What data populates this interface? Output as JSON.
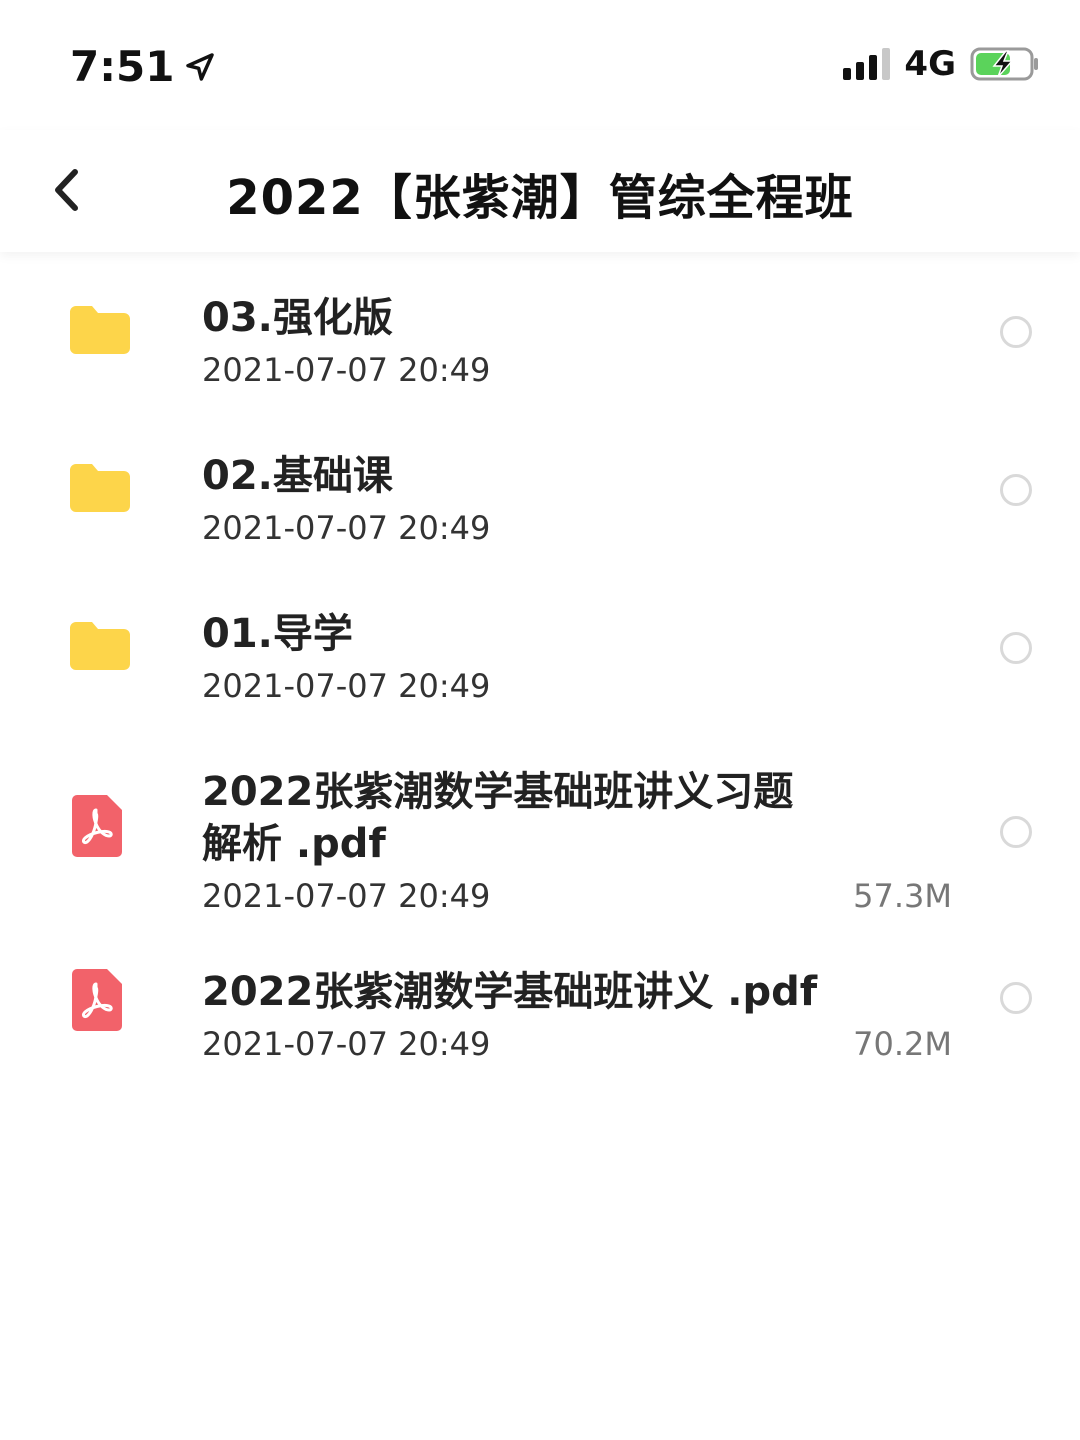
{
  "status_bar": {
    "time": "7:51",
    "network": "4G",
    "icons": [
      "location-arrow-icon",
      "signal-icon",
      "battery-charging-icon"
    ],
    "colors": {
      "battery_fill": "#5bd35b"
    }
  },
  "nav": {
    "title": "2022【张紫潮】管综全程班",
    "back_icon": "chevron-left-icon"
  },
  "files": [
    {
      "type": "folder",
      "name": "03.强化版",
      "date": "2021-07-07 20:49",
      "size": ""
    },
    {
      "type": "folder",
      "name": "02.基础课",
      "date": "2021-07-07 20:49",
      "size": ""
    },
    {
      "type": "folder",
      "name": "01.导学",
      "date": "2021-07-07 20:49",
      "size": ""
    },
    {
      "type": "pdf",
      "name": "2022张紫潮数学基础班讲义习题\n解析 .pdf",
      "date": "2021-07-07 20:49",
      "size": "57.3M"
    },
    {
      "type": "pdf",
      "name": "2022张紫潮数学基础班讲义 .pdf",
      "date": "2021-07-07 20:49",
      "size": "70.2M"
    }
  ],
  "colors": {
    "folder": "#fdd54a",
    "pdf": "#f2626a"
  }
}
